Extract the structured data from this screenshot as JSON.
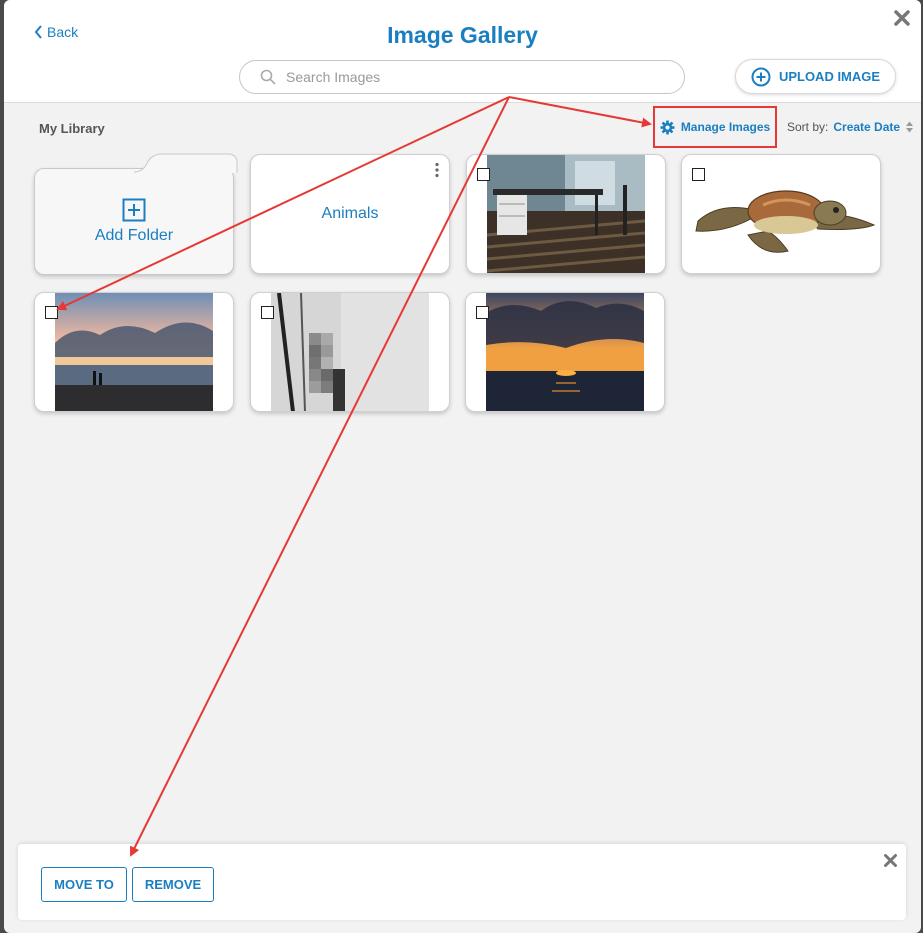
{
  "header": {
    "back_label": "Back",
    "title": "Image Gallery",
    "search_placeholder": "Search Images",
    "upload_label": "UPLOAD IMAGE"
  },
  "toolbar": {
    "library_label": "My Library",
    "manage_label": "Manage Images",
    "sort_label": "Sort by:",
    "sort_value": "Create Date"
  },
  "folders": [
    {
      "label": "Add Folder"
    },
    {
      "label": "Animals"
    }
  ],
  "images": [
    {
      "subject": "office desk with dark curtain and striped rug"
    },
    {
      "subject": "sea turtle illustration"
    },
    {
      "subject": "beach sunset with two people"
    },
    {
      "subject": "pixelated wall photo"
    },
    {
      "subject": "sunset over ocean with clouds"
    }
  ],
  "bottom_bar": {
    "move_label": "MOVE TO",
    "remove_label": "REMOVE"
  },
  "colors": {
    "accent": "#1a7fc1",
    "annotation": "#e53935"
  }
}
